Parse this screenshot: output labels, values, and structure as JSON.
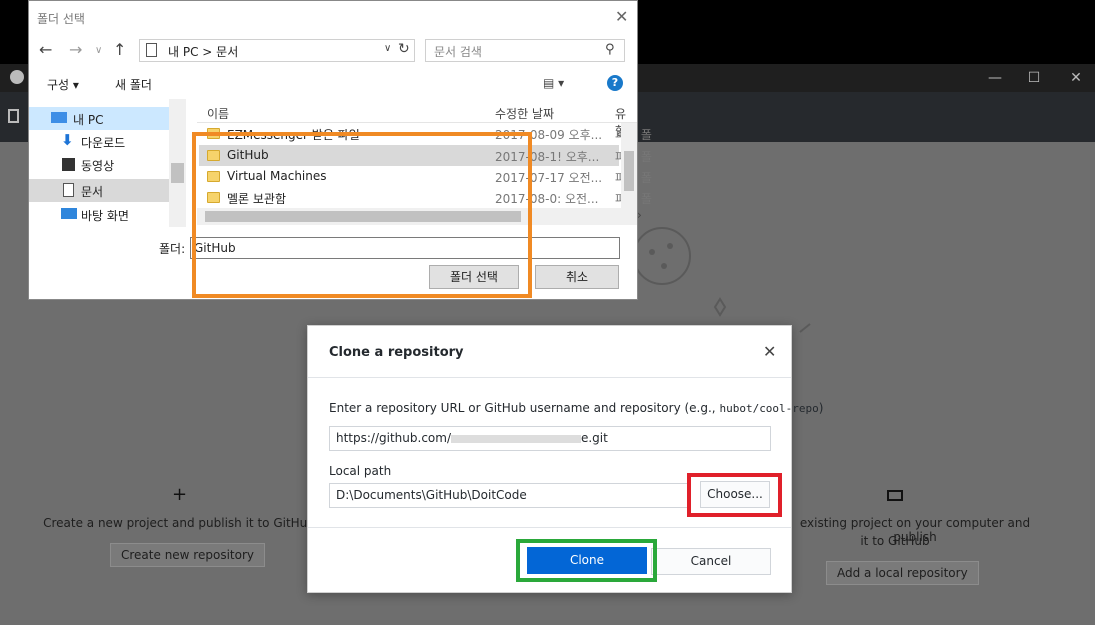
{
  "folder_dialog": {
    "title": "폴더 선택",
    "address_path": "내 PC  >  문서",
    "search_placeholder": "문서 검색",
    "organize_label": "구성 ▾",
    "new_folder_label": "새 폴더",
    "nav_items": [
      "내 PC",
      "다운로드",
      "동영상",
      "문서",
      "바탕 화면"
    ],
    "columns": [
      "이름",
      "수정한 날짜",
      "유형"
    ],
    "rows": [
      {
        "name": "EZMessenger 받은 파일",
        "date": "2017-08-09 오후...",
        "type": "파일 폴"
      },
      {
        "name": "GitHub",
        "date": "2017-08-1! 오후...",
        "type": "파일 폴"
      },
      {
        "name": "Virtual Machines",
        "date": "2017-07-17 오전...",
        "type": "파일 폴"
      },
      {
        "name": "멜론 보관함",
        "date": "2017-08-0: 오전...",
        "type": "파일 폴"
      }
    ],
    "folder_label": "폴더:",
    "folder_value": "GitHub",
    "select_button": "폴더 선택",
    "cancel_button": "취소"
  },
  "background": {
    "create_text": "Create a new project and publish it to GitHub",
    "create_button": "Create new repository",
    "add_text_line1": "existing project on your computer and publish",
    "add_text_line2": "it to GitHub",
    "add_button": "Add a local repository"
  },
  "clone_modal": {
    "title": "Clone a repository",
    "instruction_prefix": "Enter a repository URL or GitHub username and repository (e.g.,",
    "instruction_example": "hubot/cool-repo",
    "instruction_suffix": ")",
    "url_value": "https://github.com/",
    "url_value_end": "e.git",
    "local_path_label": "Local path",
    "local_path_value": "D:\\Documents\\GitHub\\DoitCode",
    "choose_button": "Choose...",
    "clone_button": "Clone",
    "cancel_button": "Cancel"
  },
  "colors": {
    "highlight_orange": "#f08a24",
    "highlight_red": "#e0202a",
    "highlight_green": "#2aa83a",
    "primary_blue": "#0366d6"
  }
}
